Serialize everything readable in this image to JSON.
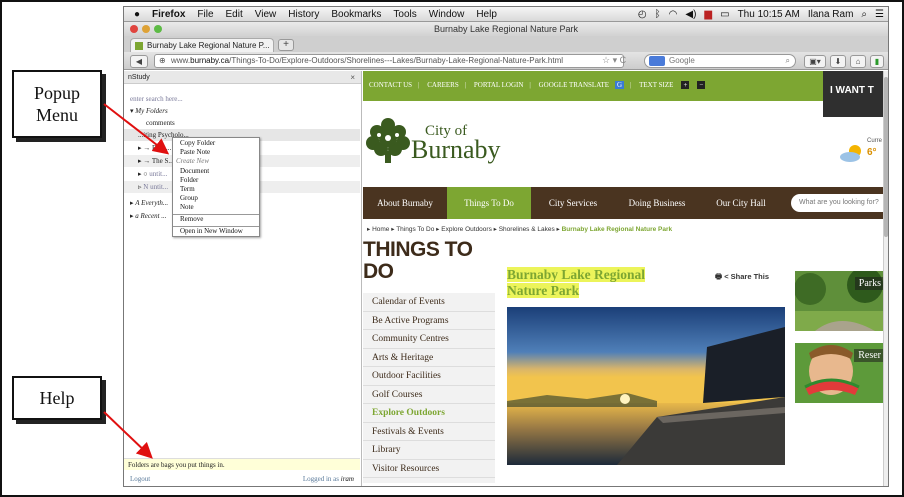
{
  "callouts": {
    "popup_label_line1": "Popup",
    "popup_label_line2": "Menu",
    "help_label": "Help"
  },
  "mac_menubar": {
    "apple": "",
    "app": "Firefox",
    "menus": [
      "File",
      "Edit",
      "View",
      "History",
      "Bookmarks",
      "Tools",
      "Window",
      "Help"
    ],
    "clock": "Thu 10:15 AM",
    "user": "Ilana Ram"
  },
  "browser": {
    "window_title": "Burnaby Lake Regional Nature Park",
    "tab_title": "Burnaby Lake Regional Nature P...",
    "new_tab": "+",
    "url_prefix": "www.",
    "url_domain": "burnaby.ca",
    "url_path": "/Things-To-Do/Explore-Outdoors/Shorelines---Lakes/Burnaby-Lake-Regional-Nature-Park.html",
    "search_placeholder": "Google"
  },
  "nstudy": {
    "title": "nStudy",
    "close": "×",
    "search_placeholder": "enter search here...",
    "tree": [
      {
        "label": "My Folders"
      },
      {
        "label": "comments"
      },
      {
        "label": "...iting Psycholo..."
      },
      {
        "label": "Burn..."
      },
      {
        "label": "The S..."
      },
      {
        "label": "untit..."
      },
      {
        "label": "N  untit..."
      },
      {
        "label": "A  Everyth..."
      },
      {
        "label": "a  Recent ..."
      }
    ],
    "help_text": "Folders are bags you put things in.",
    "logout": "Logout",
    "logged_in_prefix": "Logged in as",
    "logged_in_user": "iram"
  },
  "popup_menu": {
    "items": [
      "Copy Folder",
      "Paste Note"
    ],
    "create_header": "Create New",
    "create_items": [
      "Document",
      "Folder",
      "Term",
      "Group",
      "Note"
    ],
    "remove": "Remove",
    "open_new_window": "Open in New Window"
  },
  "website": {
    "top_links": [
      "CONTACT US",
      "CAREERS",
      "PORTAL LOGIN",
      "GOOGLE TRANSLATE",
      "TEXT SIZE"
    ],
    "text_size_plus": "+",
    "text_size_minus": "−",
    "i_want": "I WANT T",
    "logo_line1": "City of",
    "logo_line2": "Burnaby",
    "weather_label": "Curre",
    "weather_temp": "6°",
    "main_nav": [
      "About Burnaby",
      "Things To Do",
      "City Services",
      "Doing Business",
      "Our City Hall"
    ],
    "site_search_placeholder": "What are you looking for?",
    "breadcrumb": [
      "Home",
      "Things To Do",
      "Explore Outdoors",
      "Shorelines & Lakes"
    ],
    "breadcrumb_current": "Burnaby Lake Regional Nature Park",
    "section_heading": "THINGS TO DO",
    "left_nav": [
      "Calendar of Events",
      "Be Active Programs",
      "Community Centres",
      "Arts & Heritage",
      "Outdoor Facilities",
      "Golf Courses",
      "Explore Outdoors",
      "Festivals & Events",
      "Library",
      "Visitor Resources"
    ],
    "left_nav_active": "Explore Outdoors",
    "page_title": "Burnaby Lake Regional Nature Park",
    "share": "Share This",
    "thumb1_label": "Parks",
    "thumb2_label": "Reser"
  },
  "colors": {
    "burnaby_green": "#7da632",
    "nav_brown": "#4a3420",
    "highlight_yellow": "#ecf45a",
    "help_bg": "#ffffd8",
    "arrow_red": "#e01010"
  }
}
